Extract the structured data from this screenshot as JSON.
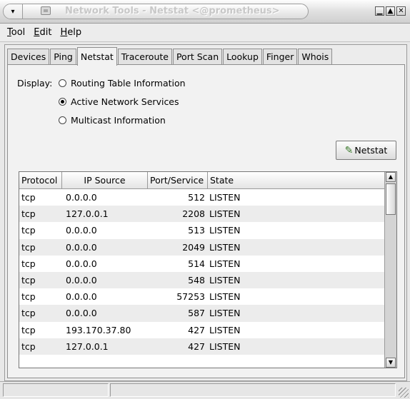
{
  "window": {
    "title": "Network Tools - Netstat <@prometheus>",
    "menu_glyph": "▾",
    "controls": {
      "minimize": "▁",
      "maximize": "▲",
      "close": "✕"
    }
  },
  "menubar": {
    "items": [
      {
        "label": "Tool",
        "mnemonic": "T",
        "rest": "ool"
      },
      {
        "label": "Edit",
        "mnemonic": "E",
        "rest": "dit"
      },
      {
        "label": "Help",
        "mnemonic": "H",
        "rest": "elp"
      }
    ]
  },
  "tabs": [
    "Devices",
    "Ping",
    "Netstat",
    "Traceroute",
    "Port Scan",
    "Lookup",
    "Finger",
    "Whois"
  ],
  "active_tab": "Netstat",
  "display": {
    "label": "Display:",
    "options": [
      {
        "label": "Routing Table Information",
        "selected": false
      },
      {
        "label": "Active Network Services",
        "selected": true
      },
      {
        "label": "Multicast Information",
        "selected": false
      }
    ]
  },
  "netstat_button": {
    "label": "Netstat",
    "icon": "wrench-hand-icon"
  },
  "table": {
    "columns": [
      "Protocol",
      "IP Source",
      "Port/Service",
      "State"
    ],
    "rows": [
      [
        "tcp",
        "0.0.0.0",
        "512",
        "LISTEN"
      ],
      [
        "tcp",
        "127.0.0.1",
        "2208",
        "LISTEN"
      ],
      [
        "tcp",
        "0.0.0.0",
        "513",
        "LISTEN"
      ],
      [
        "tcp",
        "0.0.0.0",
        "2049",
        "LISTEN"
      ],
      [
        "tcp",
        "0.0.0.0",
        "514",
        "LISTEN"
      ],
      [
        "tcp",
        "0.0.0.0",
        "548",
        "LISTEN"
      ],
      [
        "tcp",
        "0.0.0.0",
        "57253",
        "LISTEN"
      ],
      [
        "tcp",
        "0.0.0.0",
        "587",
        "LISTEN"
      ],
      [
        "tcp",
        "193.170.37.80",
        "427",
        "LISTEN"
      ],
      [
        "tcp",
        "127.0.0.1",
        "427",
        "LISTEN"
      ]
    ]
  },
  "scrollbar": {
    "up": "▲",
    "down": "▼"
  }
}
